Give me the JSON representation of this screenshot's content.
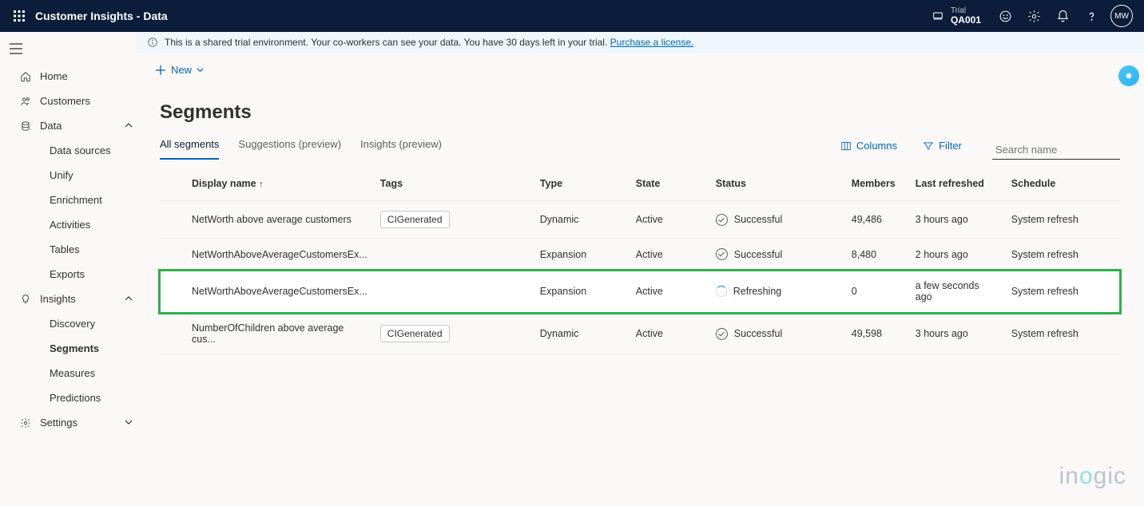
{
  "header": {
    "app_title": "Customer Insights - Data",
    "env_label": "Trial",
    "env_name": "QA001",
    "avatar_initials": "MW"
  },
  "banner": {
    "text_before": "This is a shared trial environment. Your co-workers can see your data. You have 30 days left in your trial. ",
    "link_text": "Purchase a license."
  },
  "cmdbar": {
    "new_label": "New"
  },
  "sidebar": {
    "home": "Home",
    "customers": "Customers",
    "data": "Data",
    "data_children": {
      "data_sources": "Data sources",
      "unify": "Unify",
      "enrichment": "Enrichment",
      "activities": "Activities",
      "tables": "Tables",
      "exports": "Exports"
    },
    "insights": "Insights",
    "insights_children": {
      "discovery": "Discovery",
      "segments": "Segments",
      "measures": "Measures",
      "predictions": "Predictions"
    },
    "settings": "Settings"
  },
  "page": {
    "title": "Segments",
    "tabs": {
      "all": "All segments",
      "suggestions": "Suggestions (preview)",
      "insights": "Insights (preview)"
    },
    "toolbar": {
      "columns": "Columns",
      "filter": "Filter",
      "search_placeholder": "Search name"
    },
    "columns": {
      "display_name": "Display name",
      "tags": "Tags",
      "type": "Type",
      "state": "State",
      "status": "Status",
      "members": "Members",
      "last_refreshed": "Last refreshed",
      "schedule": "Schedule"
    },
    "rows": [
      {
        "name": "NetWorth above average customers",
        "tag": "CIGenerated",
        "type": "Dynamic",
        "state": "Active",
        "status": "Successful",
        "status_kind": "success",
        "members": "49,486",
        "refreshed": "3 hours ago",
        "schedule": "System refresh",
        "highlight": false
      },
      {
        "name": "NetWorthAboveAverageCustomersEx...",
        "tag": "",
        "type": "Expansion",
        "state": "Active",
        "status": "Successful",
        "status_kind": "success",
        "members": "8,480",
        "refreshed": "2 hours ago",
        "schedule": "System refresh",
        "highlight": false
      },
      {
        "name": "NetWorthAboveAverageCustomersEx...",
        "tag": "",
        "type": "Expansion",
        "state": "Active",
        "status": "Refreshing",
        "status_kind": "refreshing",
        "members": "0",
        "refreshed": "a few seconds ago",
        "schedule": "System refresh",
        "highlight": true
      },
      {
        "name": "NumberOfChildren above average cus...",
        "tag": "CIGenerated",
        "type": "Dynamic",
        "state": "Active",
        "status": "Successful",
        "status_kind": "success",
        "members": "49,598",
        "refreshed": "3 hours ago",
        "schedule": "System refresh",
        "highlight": false
      }
    ]
  },
  "watermark": "inogic"
}
